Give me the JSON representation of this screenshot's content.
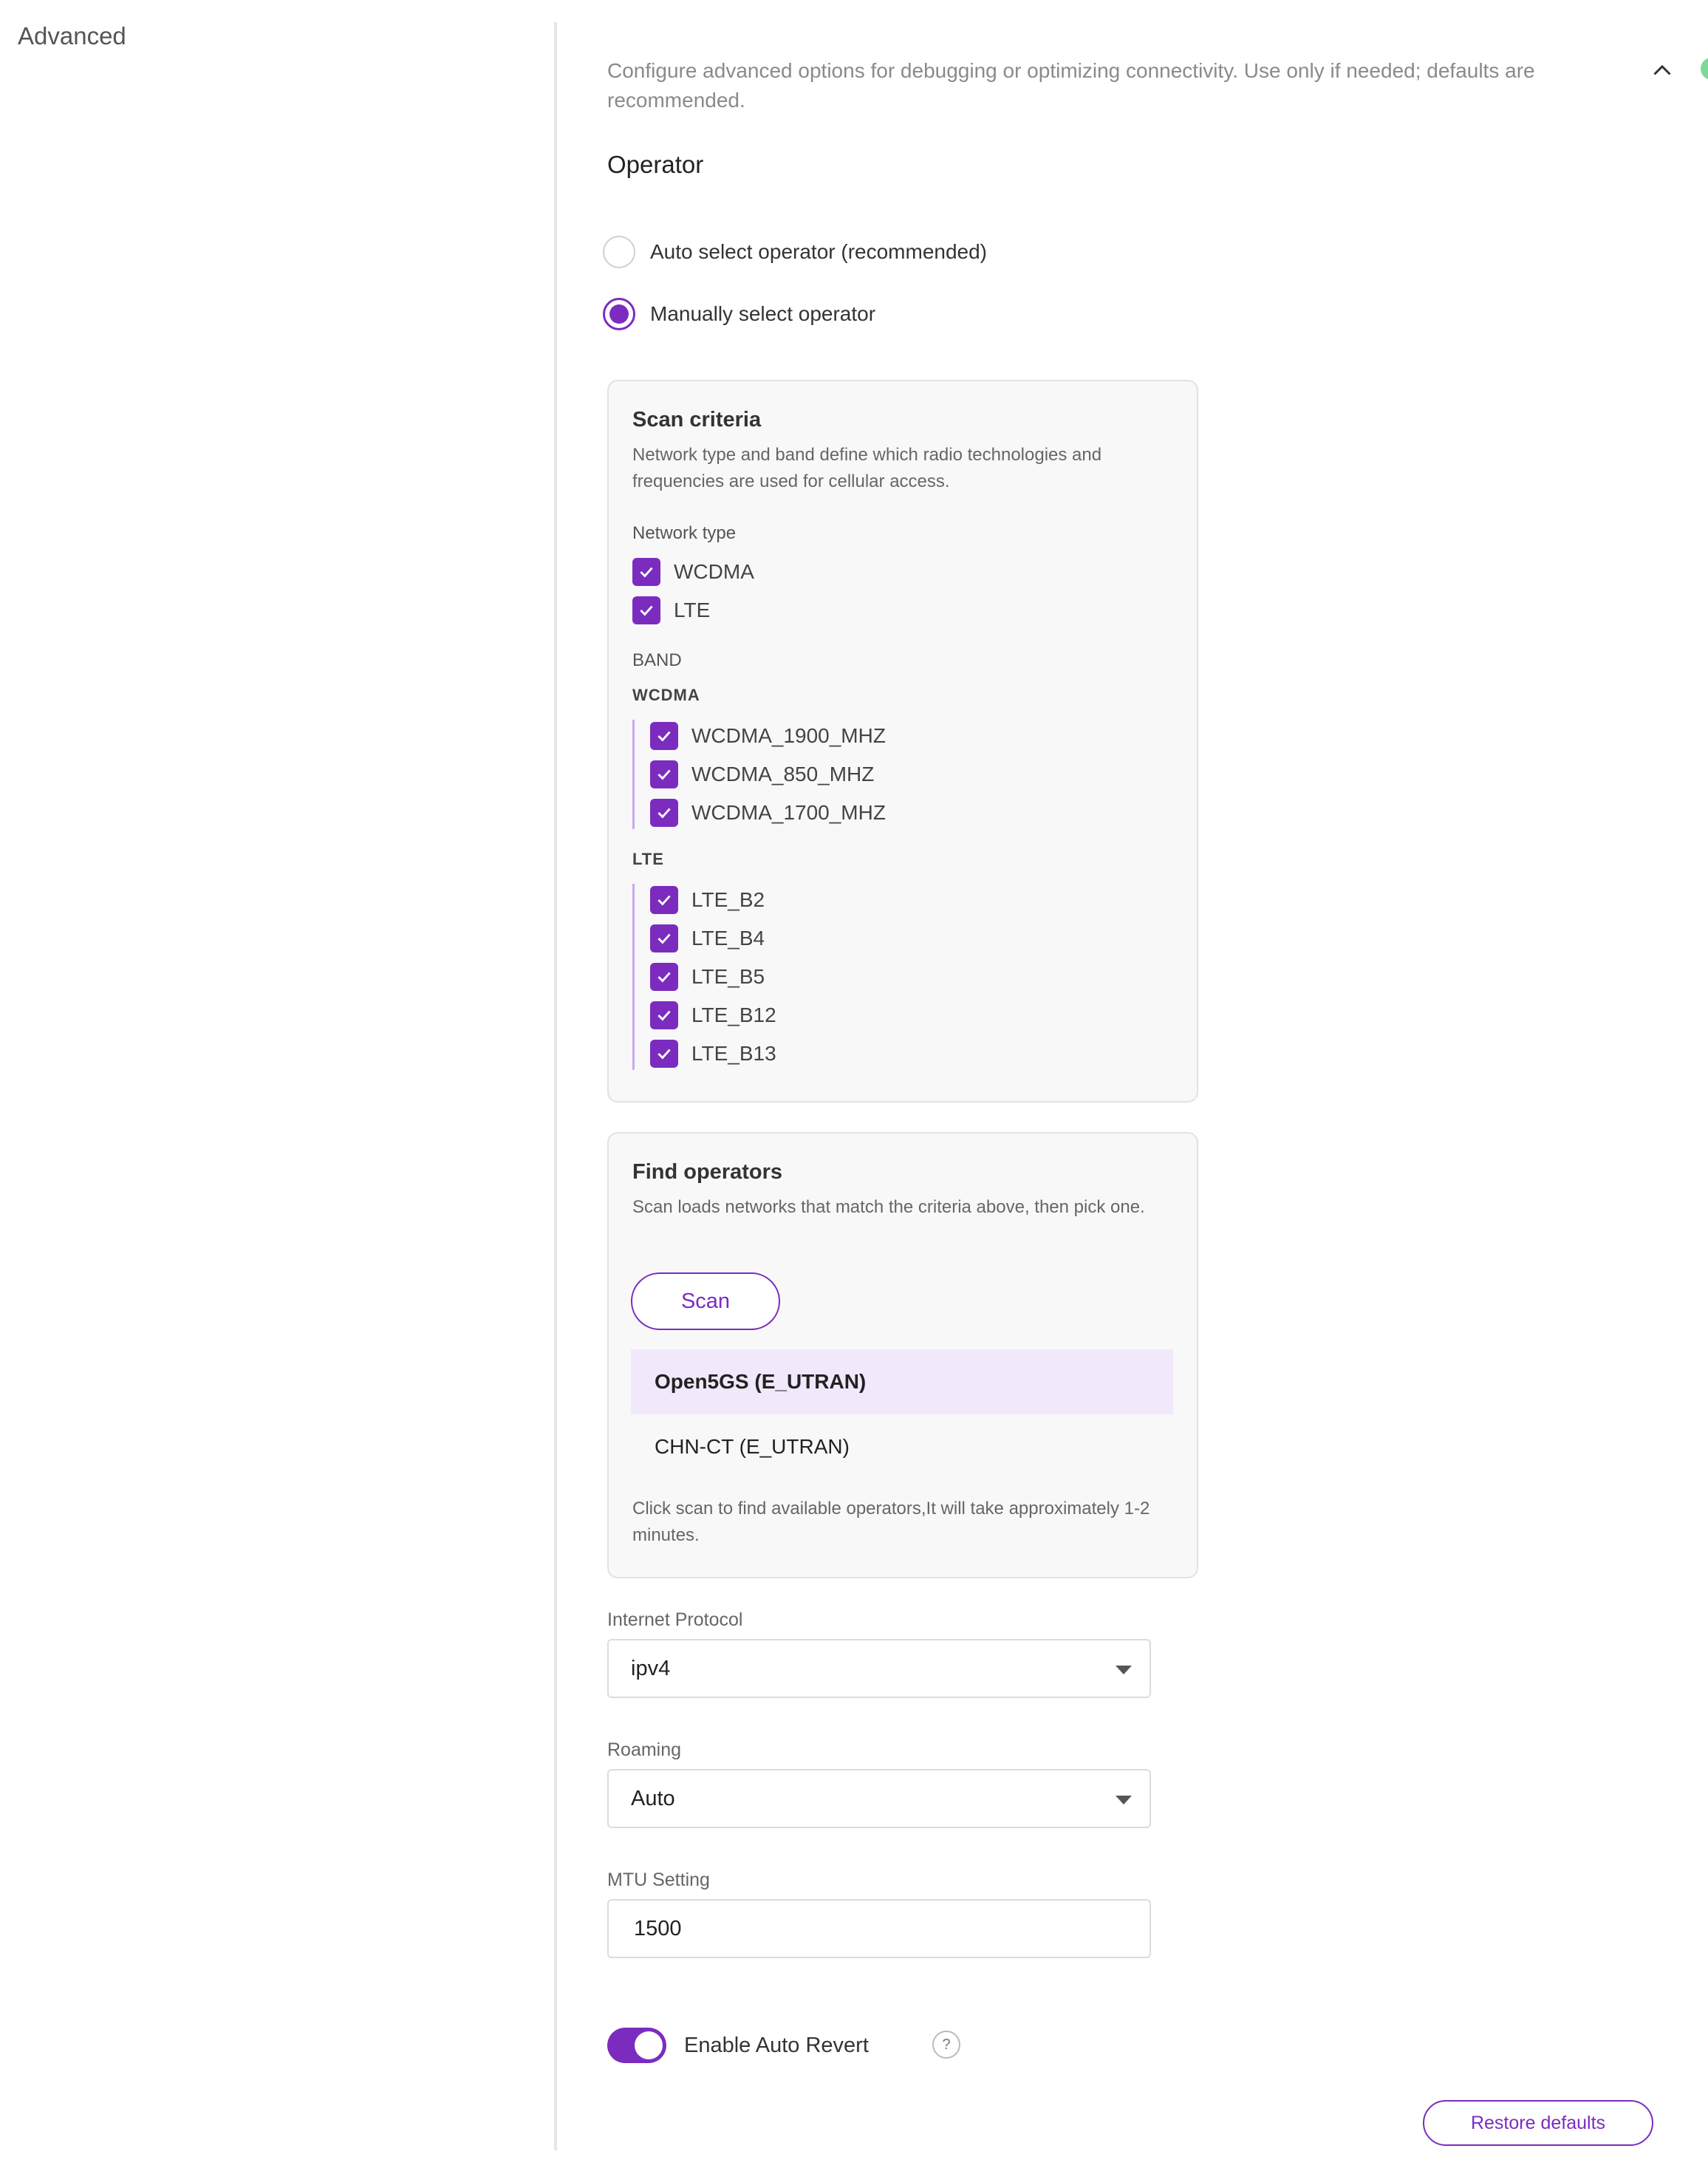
{
  "sidebar": {
    "title": "Advanced"
  },
  "header": {
    "description": "Configure advanced options for debugging or optimizing connectivity. Use only if needed; defaults are recommended.",
    "collapse_icon": "chevron-up-icon"
  },
  "operator": {
    "heading": "Operator",
    "options": [
      {
        "label": "Auto select operator (recommended)",
        "selected": false
      },
      {
        "label": "Manually select operator",
        "selected": true
      }
    ]
  },
  "scan_criteria": {
    "title": "Scan criteria",
    "subtitle": "Network type and band define which radio technologies and frequencies are used for cellular access.",
    "network_type_label": "Network type",
    "network_types": [
      {
        "label": "WCDMA",
        "checked": true
      },
      {
        "label": "LTE",
        "checked": true
      }
    ],
    "band_label": "BAND",
    "wcdma_label": "WCDMA",
    "wcdma_bands": [
      {
        "label": "WCDMA_1900_MHZ",
        "checked": true
      },
      {
        "label": "WCDMA_850_MHZ",
        "checked": true
      },
      {
        "label": "WCDMA_1700_MHZ",
        "checked": true
      }
    ],
    "lte_label": "LTE",
    "lte_bands": [
      {
        "label": "LTE_B2",
        "checked": true
      },
      {
        "label": "LTE_B4",
        "checked": true
      },
      {
        "label": "LTE_B5",
        "checked": true
      },
      {
        "label": "LTE_B12",
        "checked": true
      },
      {
        "label": "LTE_B13",
        "checked": true
      }
    ]
  },
  "find_operators": {
    "title": "Find operators",
    "subtitle": "Scan loads networks that match the criteria above, then pick one.",
    "scan_label": "Scan",
    "operators": [
      {
        "label": "Open5GS (E_UTRAN)",
        "selected": true
      },
      {
        "label": "CHN-CT (E_UTRAN)",
        "selected": false
      }
    ],
    "hint": "Click scan to find available operators,It will take approximately 1-2 minutes."
  },
  "internet_protocol": {
    "label": "Internet Protocol",
    "value": "ipv4"
  },
  "roaming": {
    "label": "Roaming",
    "value": "Auto"
  },
  "mtu": {
    "label": "MTU Setting",
    "value": "1500"
  },
  "auto_revert": {
    "label": "Enable Auto Revert",
    "enabled": true,
    "help": "?"
  },
  "footer": {
    "restore_label": "Restore defaults"
  },
  "colors": {
    "accent": "#7b2cbf",
    "selected_bg": "#f1e9fb",
    "status_dot": "#7dd89a"
  }
}
